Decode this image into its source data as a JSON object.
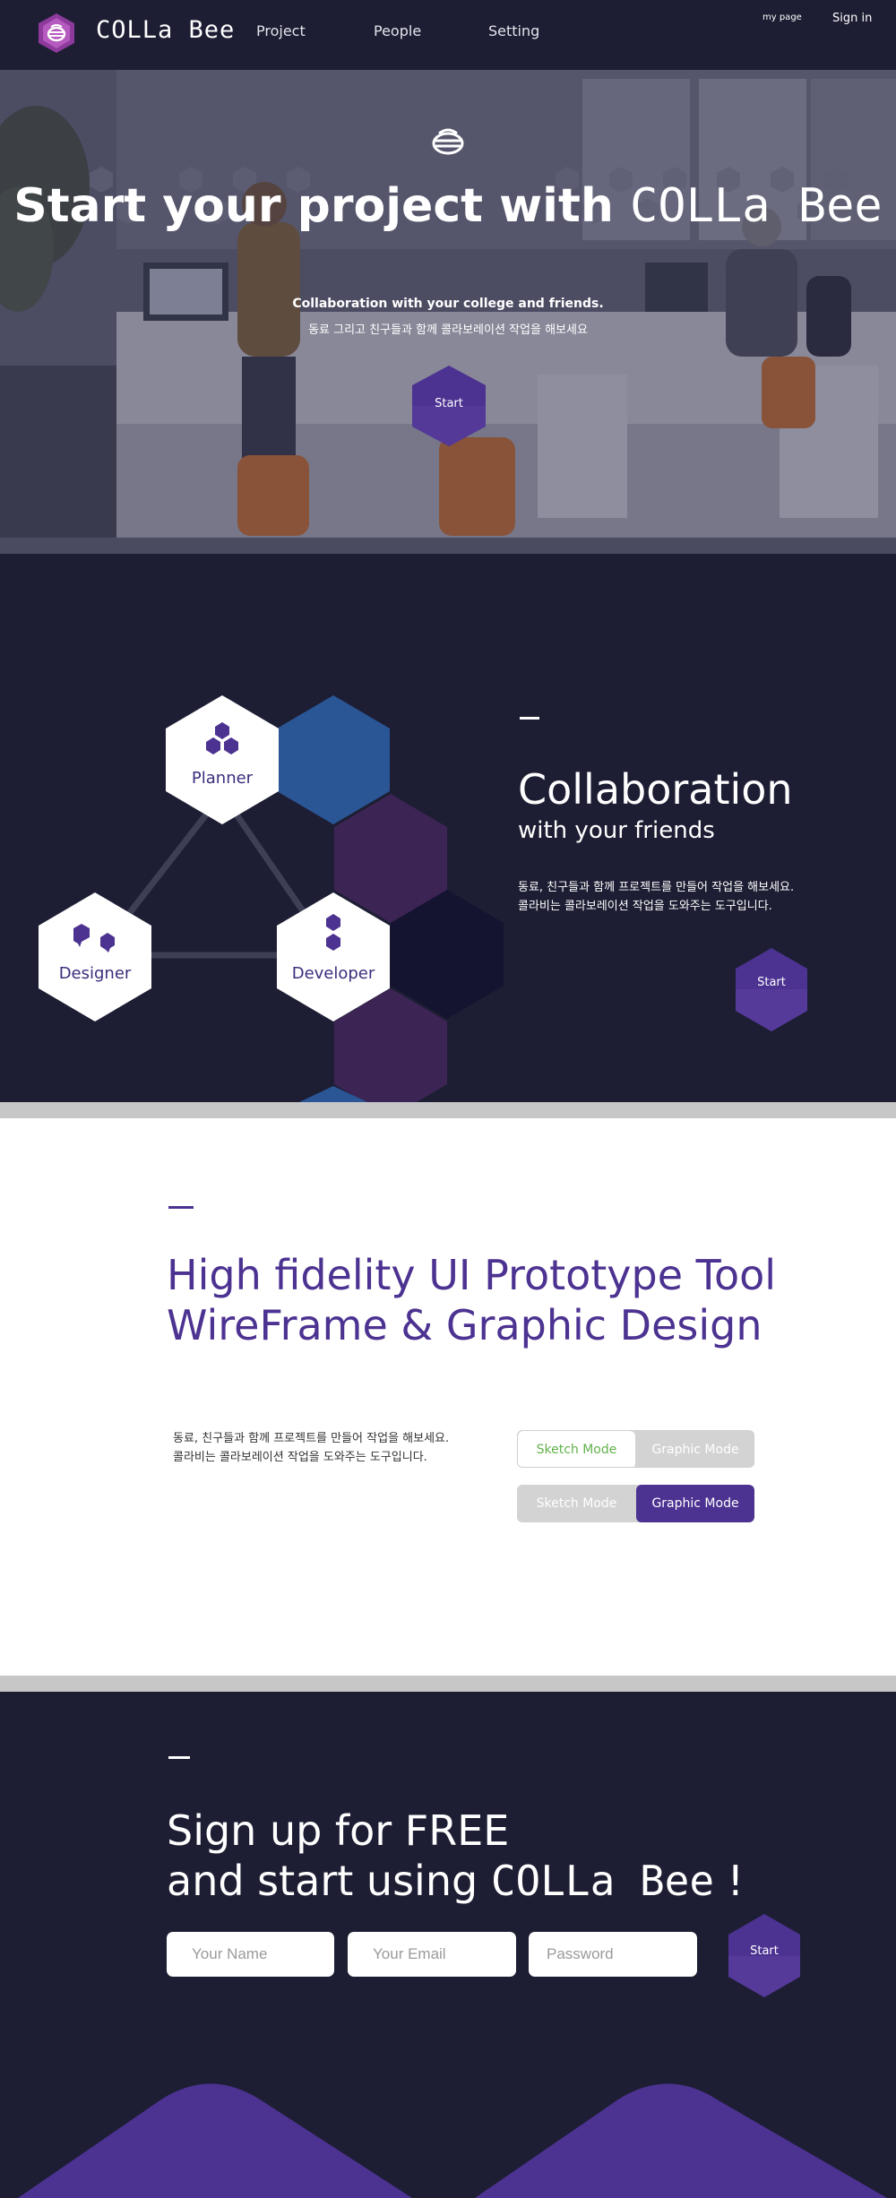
{
  "colors": {
    "navy": "#1d1e33",
    "purple": "#4c3291",
    "accent_purple": "#8e3a9c",
    "green": "#62b24a",
    "gray": "#c7c7c7"
  },
  "nav": {
    "logo_icon": "colla-bee-logo-icon",
    "brand": "COLLa Bee",
    "links": [
      {
        "label": "Project"
      },
      {
        "label": "People"
      },
      {
        "label": "Setting"
      }
    ],
    "mypage": "my page",
    "signin": "Sign in"
  },
  "hero": {
    "icon": "bee-icon",
    "title_prefix": "Start your project with ",
    "title_brand": "COLLa Bee",
    "subtitle_en": "Collaboration with your college and friends.",
    "subtitle_ko": "동료 그리고 친구들과 함께 콜라보레이션 작업을 해보세요",
    "start_label": "Start"
  },
  "collab": {
    "nodes": [
      {
        "label": "Planner"
      },
      {
        "label": "Designer"
      },
      {
        "label": "Developer"
      }
    ],
    "title": "Collaboration",
    "subtitle": "with your friends",
    "desc_line1": "동료, 친구들과 함께 프로젝트를 만들어 작업을 해보세요.",
    "desc_line2": "콜라비는 콜라보레이션 작업을 도와주는 도구입니다.",
    "start_label": "Start"
  },
  "proto": {
    "title_line1": "High fidelity UI Prototype Tool",
    "title_line2": "WireFrame & Graphic Design",
    "desc_line1": "동료, 친구들과 함께 프로젝트를 만들어 작업을 해보세요.",
    "desc_line2": "콜라비는 콜라보레이션 작업을 도와주는 도구입니다.",
    "toggle_sketch": "Sketch Mode",
    "toggle_graphic": "Graphic Mode"
  },
  "signup": {
    "line1": "Sign up for FREE",
    "line2_prefix": "and start using ",
    "line2_brand": "COLLa Bee",
    "line2_suffix": " !",
    "name_placeholder": "Your Name",
    "email_placeholder": "Your Email",
    "password_placeholder": "Password",
    "start_label": "Start"
  }
}
